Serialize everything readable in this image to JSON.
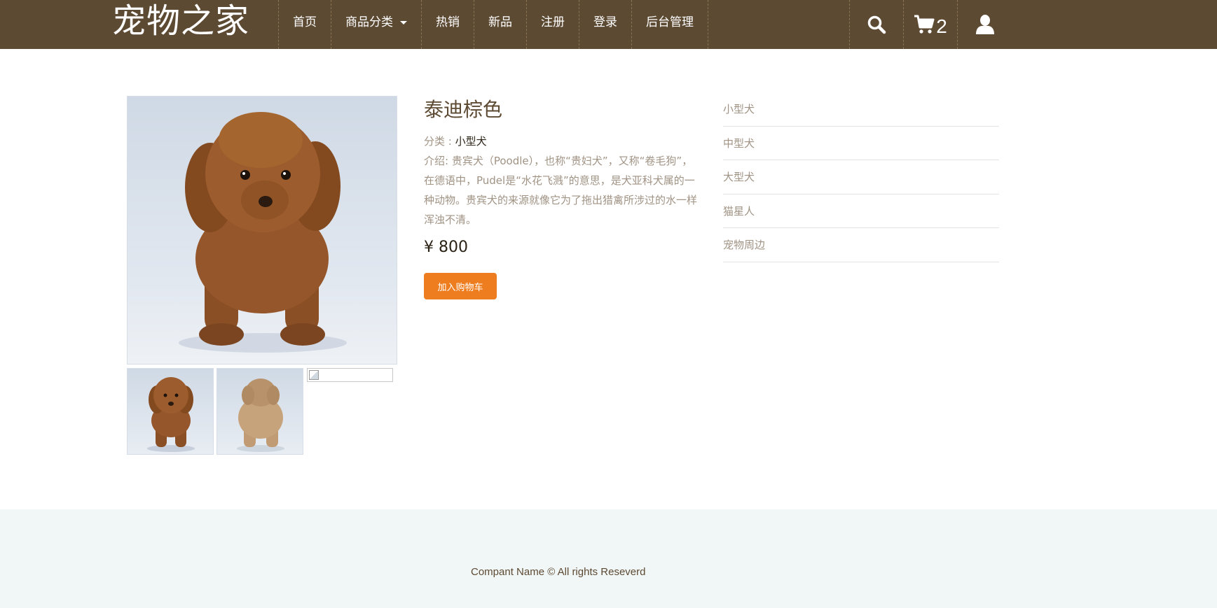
{
  "header": {
    "brand": "宠物之家",
    "nav": [
      {
        "label": "首页"
      },
      {
        "label": "商品分类",
        "dropdown": true
      },
      {
        "label": "热销"
      },
      {
        "label": "新品"
      },
      {
        "label": "注册"
      },
      {
        "label": "登录"
      },
      {
        "label": "后台管理"
      }
    ],
    "icons": {
      "search": "search-icon",
      "cart": "cart-icon",
      "user": "user-icon"
    },
    "cart_count": "2"
  },
  "product": {
    "title": "泰迪棕色",
    "category_label": "分类 : ",
    "category_value": "小型犬",
    "description": "介绍: 贵宾犬（Poodle），也称“贵妇犬”，又称“卷毛狗”，在德语中，Pudel是“水花飞溅”的意思，是犬亚科犬属的一种动物。贵宾犬的来源就像它为了拖出猎禽所涉过的水一样浑浊不清。",
    "price": "¥ 800",
    "add_to_cart": "加入购物车"
  },
  "sidebar": {
    "items": [
      {
        "label": "小型犬"
      },
      {
        "label": "中型犬"
      },
      {
        "label": "大型犬"
      },
      {
        "label": "猫星人"
      },
      {
        "label": "宠物周边"
      }
    ]
  },
  "footer": {
    "text": "Compant Name © All rights Reseverd"
  },
  "colors": {
    "navbar": "#5d4a33",
    "accent_button": "#ee7d1f",
    "footer_bg": "#f1f6f6"
  }
}
